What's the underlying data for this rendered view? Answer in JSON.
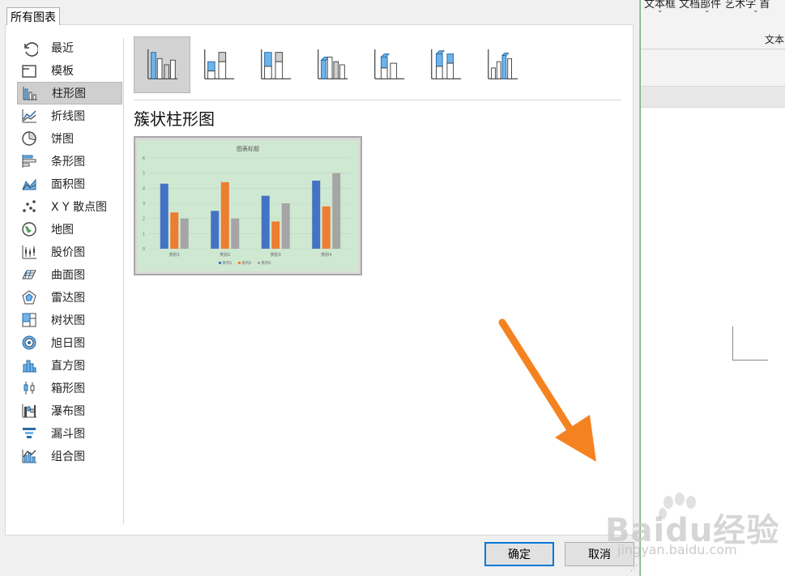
{
  "dialog": {
    "tab_label": "所有图表",
    "chart_types": [
      {
        "label": "最近",
        "icon": "recent-icon"
      },
      {
        "label": "模板",
        "icon": "template-icon"
      },
      {
        "label": "柱形图",
        "icon": "column-chart-icon",
        "selected": true
      },
      {
        "label": "折线图",
        "icon": "line-chart-icon"
      },
      {
        "label": "饼图",
        "icon": "pie-chart-icon"
      },
      {
        "label": "条形图",
        "icon": "bar-chart-icon"
      },
      {
        "label": "面积图",
        "icon": "area-chart-icon"
      },
      {
        "label": "X Y 散点图",
        "icon": "scatter-chart-icon"
      },
      {
        "label": "地图",
        "icon": "map-chart-icon"
      },
      {
        "label": "股价图",
        "icon": "stock-chart-icon"
      },
      {
        "label": "曲面图",
        "icon": "surface-chart-icon"
      },
      {
        "label": "雷达图",
        "icon": "radar-chart-icon"
      },
      {
        "label": "树状图",
        "icon": "treemap-chart-icon"
      },
      {
        "label": "旭日图",
        "icon": "sunburst-chart-icon"
      },
      {
        "label": "直方图",
        "icon": "histogram-chart-icon"
      },
      {
        "label": "箱形图",
        "icon": "box-whisker-chart-icon"
      },
      {
        "label": "瀑布图",
        "icon": "waterfall-chart-icon"
      },
      {
        "label": "漏斗图",
        "icon": "funnel-chart-icon"
      },
      {
        "label": "组合图",
        "icon": "combo-chart-icon"
      }
    ],
    "subtypes": [
      {
        "icon": "clustered-column-icon",
        "selected": true
      },
      {
        "icon": "stacked-column-icon"
      },
      {
        "icon": "100-percent-stacked-column-icon"
      },
      {
        "icon": "3d-clustered-column-icon"
      },
      {
        "icon": "3d-stacked-column-icon"
      },
      {
        "icon": "3d-100-percent-stacked-column-icon"
      },
      {
        "icon": "3d-column-icon"
      }
    ],
    "section_title": "簇状柱形图",
    "ok_label": "确定",
    "cancel_label": "取消"
  },
  "background_app": {
    "ribbon_tab_fragment": "文本框  文档部件  艺术字  首",
    "group_label": "文本"
  },
  "watermark": {
    "text": "Baidu经验",
    "sub": "jingyan.baidu.com"
  },
  "colors": {
    "series1": "#4472c4",
    "series2": "#ed7d31",
    "series3": "#a5a5a5",
    "preview_bg": "#cfe8d2",
    "arrow": "#f58220",
    "accent": "#0078d7"
  },
  "chart_data": {
    "type": "bar",
    "title": "图表标题",
    "categories": [
      "类别1",
      "类别2",
      "类别3",
      "类别4"
    ],
    "series": [
      {
        "name": "系列1",
        "values": [
          4.3,
          2.5,
          3.5,
          4.5
        ]
      },
      {
        "name": "系列2",
        "values": [
          2.4,
          4.4,
          1.8,
          2.8
        ]
      },
      {
        "name": "系列3",
        "values": [
          2,
          2,
          3,
          5
        ]
      }
    ],
    "ylim": [
      0,
      6
    ],
    "yticks": [
      "0",
      "1",
      "2",
      "3",
      "4",
      "5",
      "6"
    ],
    "grid": true,
    "legend": "bottom"
  }
}
